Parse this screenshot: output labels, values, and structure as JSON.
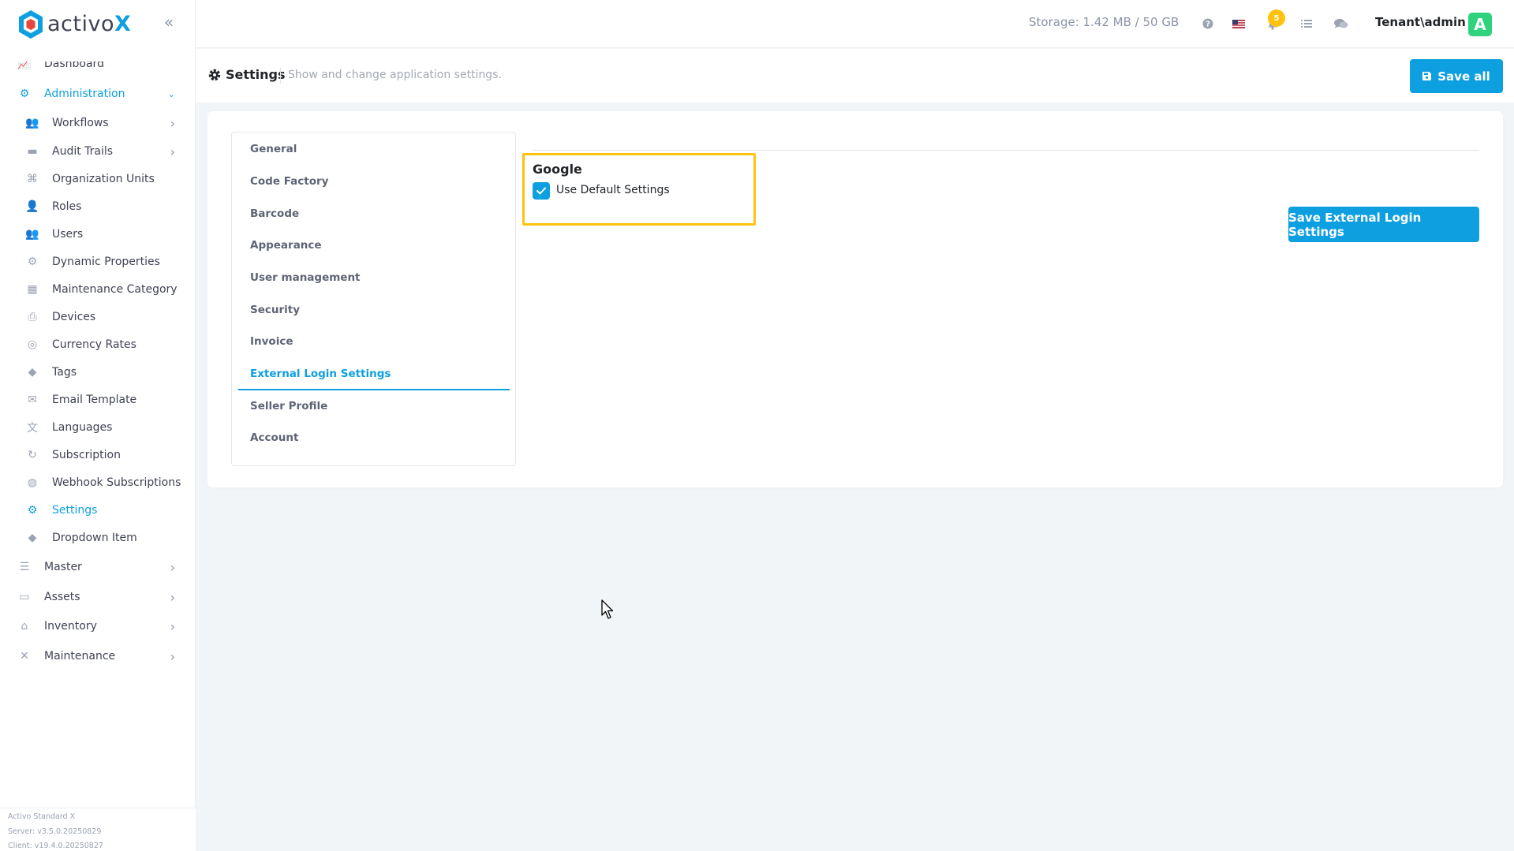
{
  "brand": {
    "name_main": "activo",
    "name_accent": "X"
  },
  "sidebar": {
    "items": [
      {
        "label": "Dashboard",
        "icon": "chart-line-icon",
        "level": "top"
      },
      {
        "label": "Administration",
        "icon": "gears-icon",
        "level": "top",
        "active": true,
        "arrow": "chevron-down-icon"
      },
      {
        "label": "Workflows",
        "icon": "users-icon",
        "level": "sub",
        "arrow": "chevron-right-icon"
      },
      {
        "label": "Audit Trails",
        "icon": "folder-icon",
        "level": "sub",
        "arrow": "chevron-right-icon"
      },
      {
        "label": "Organization Units",
        "icon": "sitemap-icon",
        "level": "sub"
      },
      {
        "label": "Roles",
        "icon": "user-tag-icon",
        "level": "sub"
      },
      {
        "label": "Users",
        "icon": "users-icon",
        "level": "sub"
      },
      {
        "label": "Dynamic Properties",
        "icon": "gear-icon",
        "level": "sub"
      },
      {
        "label": "Maintenance Category",
        "icon": "grid-icon",
        "level": "sub"
      },
      {
        "label": "Devices",
        "icon": "printer-icon",
        "level": "sub"
      },
      {
        "label": "Currency Rates",
        "icon": "coins-icon",
        "level": "sub"
      },
      {
        "label": "Tags",
        "icon": "tags-icon",
        "level": "sub"
      },
      {
        "label": "Email Template",
        "icon": "envelope-icon",
        "level": "sub"
      },
      {
        "label": "Languages",
        "icon": "language-icon",
        "level": "sub"
      },
      {
        "label": "Subscription",
        "icon": "refresh-icon",
        "level": "sub"
      },
      {
        "label": "Webhook Subscriptions",
        "icon": "globe-icon",
        "level": "sub"
      },
      {
        "label": "Settings",
        "icon": "gear-icon",
        "level": "sub",
        "active": true
      },
      {
        "label": "Dropdown Item",
        "icon": "tags-icon",
        "level": "sub"
      },
      {
        "label": "Master",
        "icon": "database-icon",
        "level": "top",
        "arrow": "chevron-right-icon"
      },
      {
        "label": "Assets",
        "icon": "laptop-icon",
        "level": "top",
        "arrow": "chevron-right-icon"
      },
      {
        "label": "Inventory",
        "icon": "warehouse-icon",
        "level": "top",
        "arrow": "chevron-right-icon"
      },
      {
        "label": "Maintenance",
        "icon": "tools-icon",
        "level": "top",
        "arrow": "chevron-right-icon"
      }
    ],
    "footer": {
      "product": "Activo Standard X",
      "server": "Server: v3.5.0.20250829",
      "client": "Client: v19.4.0.20250827"
    }
  },
  "topbar": {
    "storage": "Storage: 1.42 MB / 50 GB",
    "notifications_count": "5",
    "user": "Tenant\\admin",
    "avatar_letter": "A"
  },
  "subheader": {
    "title": "Settings",
    "description": "Show and change application settings.",
    "save_all": "Save all"
  },
  "tabs": [
    {
      "label": "General"
    },
    {
      "label": "Code Factory"
    },
    {
      "label": "Barcode"
    },
    {
      "label": "Appearance"
    },
    {
      "label": "User management"
    },
    {
      "label": "Security"
    },
    {
      "label": "Invoice"
    },
    {
      "label": "External Login Settings",
      "active": true
    },
    {
      "label": "Seller Profile"
    },
    {
      "label": "Account"
    }
  ],
  "external_login": {
    "provider": "Google",
    "use_default_label": "Use Default Settings",
    "use_default_checked": true,
    "save_button": "Save External Login Settings"
  },
  "colors": {
    "accent": "#0e9fe0",
    "highlight": "#ffc20e",
    "avatar": "#2fd37d"
  }
}
